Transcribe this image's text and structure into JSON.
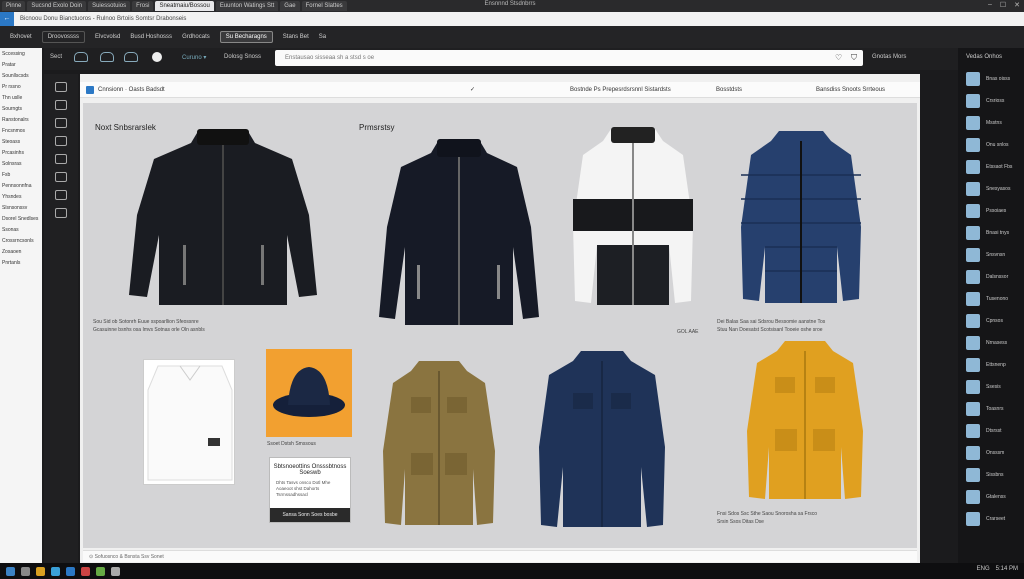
{
  "browser": {
    "tabs": [
      "Pinne",
      "Sucsnd Exolo Doin",
      "Suiessotuios",
      "Frosi",
      "Sneatmaiu/Bossou",
      "Euunton Watings Stt",
      "Gae",
      "Fornel Slattes"
    ],
    "window_title": "Ensnnnd Stsdnbrrs",
    "window_controls": [
      "–",
      "☐",
      "✕"
    ],
    "url_text": "Bicnoou Donu Bianctuoros - Rulnoo Brtoiis Somtsr Drabonseis"
  },
  "toolbar": {
    "items": [
      "Bxhovet",
      "Droovossss",
      "Elvcvolsd",
      "Busd Hoshosss",
      "Grdhocats",
      "Su Becharagns",
      "Stans Bet",
      "Sa"
    ],
    "left_label": "Sect",
    "dropdown_label": "Curuno ▾",
    "dropdown2_label": "Dolosg Snoss",
    "right_label": "Gnotas  Mors"
  },
  "search": {
    "placeholder": "Enstausao sisseaa sh a stsd s oe"
  },
  "main_header": {
    "left": "Cnnsionn · Oasts Badsdt",
    "mid": "Bostnde Ps Prepesrdsrsnnl Sistardsts",
    "right": "Bosstdsts",
    "right2": "Bansdiss Snoots Srrteous"
  },
  "canvas": {
    "label_left": "Noxt Snbsrarslek",
    "label_right": "Prmsrstsy",
    "caption_row1_left": "Sou Sid ob Sotonrh Euue sspoarllion Sfeossnre",
    "caption_row1_left2": "Gcasuinne bsnhs osa Imvs Sotnas orle Oln asnbls",
    "caption_row1_mid": "GOL AAE",
    "caption_row1_right": "Dei Balas  Saa sai Sdsrou Bessomie aanstne Tos",
    "caption_row1_right2": "Stuu Nan Doesatst Scotsisanl Tooeie oshe sroe",
    "hat_caption": "Ssoet Dstsh Smssous",
    "promo_title": "Sbtsnoeottins Onsssbtnoss Soeswb",
    "promo_body": "Dhts Tasvs onsco Dotl Mhe Aoaeoot shst Dahorts Tsrmssadhssacl",
    "promo_button": "Sansa Sonn Soes bosbe",
    "caption_row2_right": "Fnsi  Sdos Ssc Sthe Saou Snorosha sa Frsco",
    "caption_row2_right2": "Srsin Ssos Ditas Dse"
  },
  "left_panel": {
    "items": [
      "Sccessing",
      "Pratar",
      "Sounllscsds",
      "Pr rssno",
      "Thn uslle",
      "Sourngts",
      "Ranstonalrs",
      "Fncsnmos",
      "Steoass",
      "Prcasinhs",
      "Solnsras",
      "Fsb",
      "Pennsonnfna",
      "Yhsndes",
      "Slsnsonssv",
      "Dsorel Snedlses",
      "Ssonas",
      "Crossrncsonls",
      "Zosaoen",
      "Pnrtanls"
    ]
  },
  "right_panel": {
    "header": "Vedas  Onhos",
    "items": [
      "Bnas oisss",
      "Crsrioss",
      "Msstns",
      "Onu snlos",
      "Etssaot Fbs",
      "Snesyasos",
      "Pssoiaes",
      "Bnasi tnys",
      "Snsvnsn",
      "Dalsnssor",
      "Tusenono",
      "Cpnsos",
      "Nrnasess",
      "Ettsnenp",
      "Ssesis",
      "Toasnrs",
      "Dtsrsst",
      "Onsssm",
      "Sissbns",
      "Gtalenss",
      "Crarseet",
      "Bessor",
      "Sestsns"
    ]
  },
  "status_bar": {
    "text": "⊙ Sofuosnco & Bsnsta Ssv Sonet"
  },
  "taskbar": {
    "time": "5:14 PM",
    "date": "ENG"
  },
  "colors": {
    "accent_blue": "#2b78c5",
    "hat_orange": "#f2a030",
    "jacket_yellow": "#e0a020",
    "jacket_navy": "#1f3358",
    "jacket_olive": "#8a7440"
  }
}
